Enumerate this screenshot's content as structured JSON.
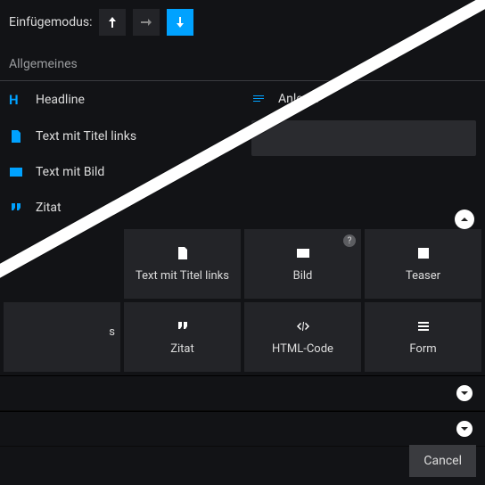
{
  "top": {
    "label": "Einfügemodus:"
  },
  "section": {
    "title": "Allgemeines"
  },
  "list": {
    "left": [
      {
        "icon": "H",
        "label": "Headline"
      },
      {
        "icon": "doc",
        "label": "Text mit Titel links"
      },
      {
        "icon": "image",
        "label": "Text mit Bild"
      },
      {
        "icon": "quote",
        "label": "Zitat"
      }
    ],
    "right": [
      {
        "icon": "anl",
        "label": "Anleser"
      }
    ]
  },
  "tiles": {
    "row1": [
      {
        "icon": "doc",
        "label": "Text mit Titel links"
      },
      {
        "icon": "image",
        "label": "Bild",
        "help": true
      },
      {
        "icon": "teaser",
        "label": "Teaser"
      }
    ],
    "row2": [
      {
        "icon": "",
        "label": "s",
        "cut": true
      },
      {
        "icon": "quote",
        "label": "Zitat"
      },
      {
        "icon": "code",
        "label": "HTML-Code"
      },
      {
        "icon": "form",
        "label": "Form"
      }
    ]
  },
  "footer": {
    "cancel": "Cancel"
  }
}
